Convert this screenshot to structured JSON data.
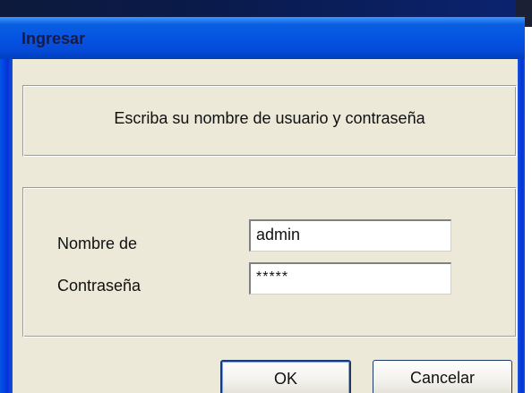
{
  "window": {
    "title": "Ingresar"
  },
  "instruction": {
    "text": "Escriba su nombre de usuario y contraseña"
  },
  "form": {
    "username_label": "Nombre de",
    "username_value": "admin",
    "password_label": "Contraseña",
    "password_value": "*****"
  },
  "buttons": {
    "ok_label": "OK",
    "cancel_label": "Cancelar"
  },
  "colors": {
    "titlebar": "#0554e3",
    "dialog_bg": "#ece9d8",
    "title_text": "#1a1a40"
  }
}
